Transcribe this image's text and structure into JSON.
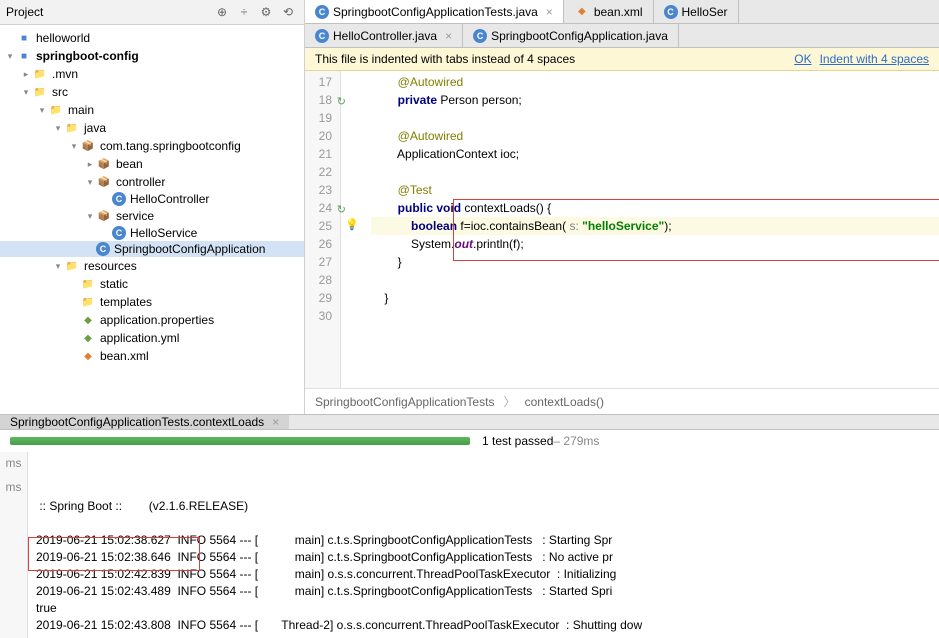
{
  "sidebar": {
    "title": "Project",
    "toolbar": [
      "⊕",
      "÷",
      "⚙",
      "⟲"
    ],
    "tree": [
      {
        "indent": 0,
        "arrow": "",
        "icon": "proj",
        "label": "helloworld",
        "bold": false
      },
      {
        "indent": 0,
        "arrow": "▾",
        "icon": "proj",
        "label": "springboot-config",
        "bold": true
      },
      {
        "indent": 1,
        "arrow": "▸",
        "icon": "folder",
        "label": ".mvn",
        "bold": false
      },
      {
        "indent": 1,
        "arrow": "▾",
        "icon": "folder",
        "label": "src",
        "bold": false
      },
      {
        "indent": 2,
        "arrow": "▾",
        "icon": "folder",
        "label": "main",
        "bold": false
      },
      {
        "indent": 3,
        "arrow": "▾",
        "icon": "folder",
        "label": "java",
        "bold": false
      },
      {
        "indent": 4,
        "arrow": "▾",
        "icon": "pkg",
        "label": "com.tang.springbootconfig",
        "bold": false
      },
      {
        "indent": 5,
        "arrow": "▸",
        "icon": "pkg",
        "label": "bean",
        "bold": false
      },
      {
        "indent": 5,
        "arrow": "▾",
        "icon": "pkg",
        "label": "controller",
        "bold": false
      },
      {
        "indent": 6,
        "arrow": "",
        "icon": "class",
        "label": "HelloController",
        "bold": false
      },
      {
        "indent": 5,
        "arrow": "▾",
        "icon": "pkg",
        "label": "service",
        "bold": false
      },
      {
        "indent": 6,
        "arrow": "",
        "icon": "class",
        "label": "HelloService",
        "bold": false
      },
      {
        "indent": 5,
        "arrow": "",
        "icon": "class",
        "label": "SpringbootConfigApplication",
        "bold": false,
        "selected": true
      },
      {
        "indent": 3,
        "arrow": "▾",
        "icon": "folder",
        "label": "resources",
        "bold": false
      },
      {
        "indent": 4,
        "arrow": "",
        "icon": "folder",
        "label": "static",
        "bold": false
      },
      {
        "indent": 4,
        "arrow": "",
        "icon": "folder",
        "label": "templates",
        "bold": false
      },
      {
        "indent": 4,
        "arrow": "",
        "icon": "prop",
        "label": "application.properties",
        "bold": false
      },
      {
        "indent": 4,
        "arrow": "",
        "icon": "yml",
        "label": "application.yml",
        "bold": false
      },
      {
        "indent": 4,
        "arrow": "",
        "icon": "xml",
        "label": "bean.xml",
        "bold": false
      }
    ]
  },
  "tabs1": [
    {
      "icon": "class",
      "label": "SpringbootConfigApplicationTests.java",
      "active": true,
      "close": "×"
    },
    {
      "icon": "xml",
      "label": "bean.xml",
      "active": false,
      "close": ""
    },
    {
      "icon": "class",
      "label": "HelloSer",
      "active": false,
      "close": ""
    }
  ],
  "tabs2": [
    {
      "icon": "class",
      "label": "HelloController.java",
      "active": false,
      "close": "×"
    },
    {
      "icon": "class",
      "label": "SpringbootConfigApplication.java",
      "active": false,
      "close": ""
    }
  ],
  "infobar": {
    "msg": "This file is indented with tabs instead of 4 spaces",
    "ok": "OK",
    "action": "Indent with 4 spaces"
  },
  "code": {
    "start": 17,
    "lines": [
      {
        "n": 17,
        "hl": false,
        "gi": "",
        "ic": "",
        "t": "        @Autowired",
        "cls": "at"
      },
      {
        "n": 18,
        "hl": false,
        "gi": "↻",
        "ic": "",
        "t": "        private Person person;",
        "k": [
          "private"
        ]
      },
      {
        "n": 19,
        "hl": false,
        "gi": "",
        "ic": "",
        "t": ""
      },
      {
        "n": 20,
        "hl": false,
        "gi": "",
        "ic": "",
        "t": "        @Autowired",
        "cls": "at"
      },
      {
        "n": 21,
        "hl": false,
        "gi": "",
        "ic": "",
        "t": "        ApplicationContext ioc;"
      },
      {
        "n": 22,
        "hl": false,
        "gi": "",
        "ic": "",
        "t": ""
      },
      {
        "n": 23,
        "hl": false,
        "gi": "",
        "ic": "",
        "t": "        @Test",
        "cls": "at"
      },
      {
        "n": 24,
        "hl": false,
        "gi": "↻",
        "ic": "",
        "t": "        public void contextLoads() {",
        "k": [
          "public",
          "void"
        ]
      },
      {
        "n": 25,
        "hl": true,
        "gi": "",
        "ic": "💡",
        "t": "            boolean f=ioc.containsBean( s: \"helloService\");",
        "k": [
          "boolean"
        ],
        "s": [
          "\"helloService\""
        ],
        "p": [
          "s:"
        ]
      },
      {
        "n": 26,
        "hl": false,
        "gi": "",
        "ic": "",
        "t": "            System.out.println(f);",
        "it": [
          "out"
        ]
      },
      {
        "n": 27,
        "hl": false,
        "gi": "",
        "ic": "",
        "t": "        }"
      },
      {
        "n": 28,
        "hl": false,
        "gi": "",
        "ic": "",
        "t": ""
      },
      {
        "n": 29,
        "hl": false,
        "gi": "",
        "ic": "",
        "t": "    }"
      },
      {
        "n": 30,
        "hl": false,
        "gi": "",
        "ic": "",
        "t": ""
      }
    ],
    "breadcrumb": [
      "SpringbootConfigApplicationTests",
      "contextLoads()"
    ]
  },
  "test": {
    "tab": "SpringbootConfigApplicationTests.contextLoads",
    "status": "1 test passed",
    "time": " – 279ms"
  },
  "console": {
    "gutter": [
      "ms",
      "ms"
    ],
    "lines": [
      " :: Spring Boot ::        (v2.1.6.RELEASE)",
      "",
      "2019-06-21 15:02:38.627  INFO 5564 --- [           main] c.t.s.SpringbootConfigApplicationTests   : Starting Spr",
      "2019-06-21 15:02:38.646  INFO 5564 --- [           main] c.t.s.SpringbootConfigApplicationTests   : No active pr",
      "2019-06-21 15:02:42.839  INFO 5564 --- [           main] o.s.s.concurrent.ThreadPoolTaskExecutor  : Initializing",
      "2019-06-21 15:02:43.489  INFO 5564 --- [           main] c.t.s.SpringbootConfigApplicationTests   : Started Spri",
      "true",
      "2019-06-21 15:02:43.808  INFO 5564 --- [       Thread-2] o.s.s.concurrent.ThreadPoolTaskExecutor  : Shutting dow"
    ]
  }
}
